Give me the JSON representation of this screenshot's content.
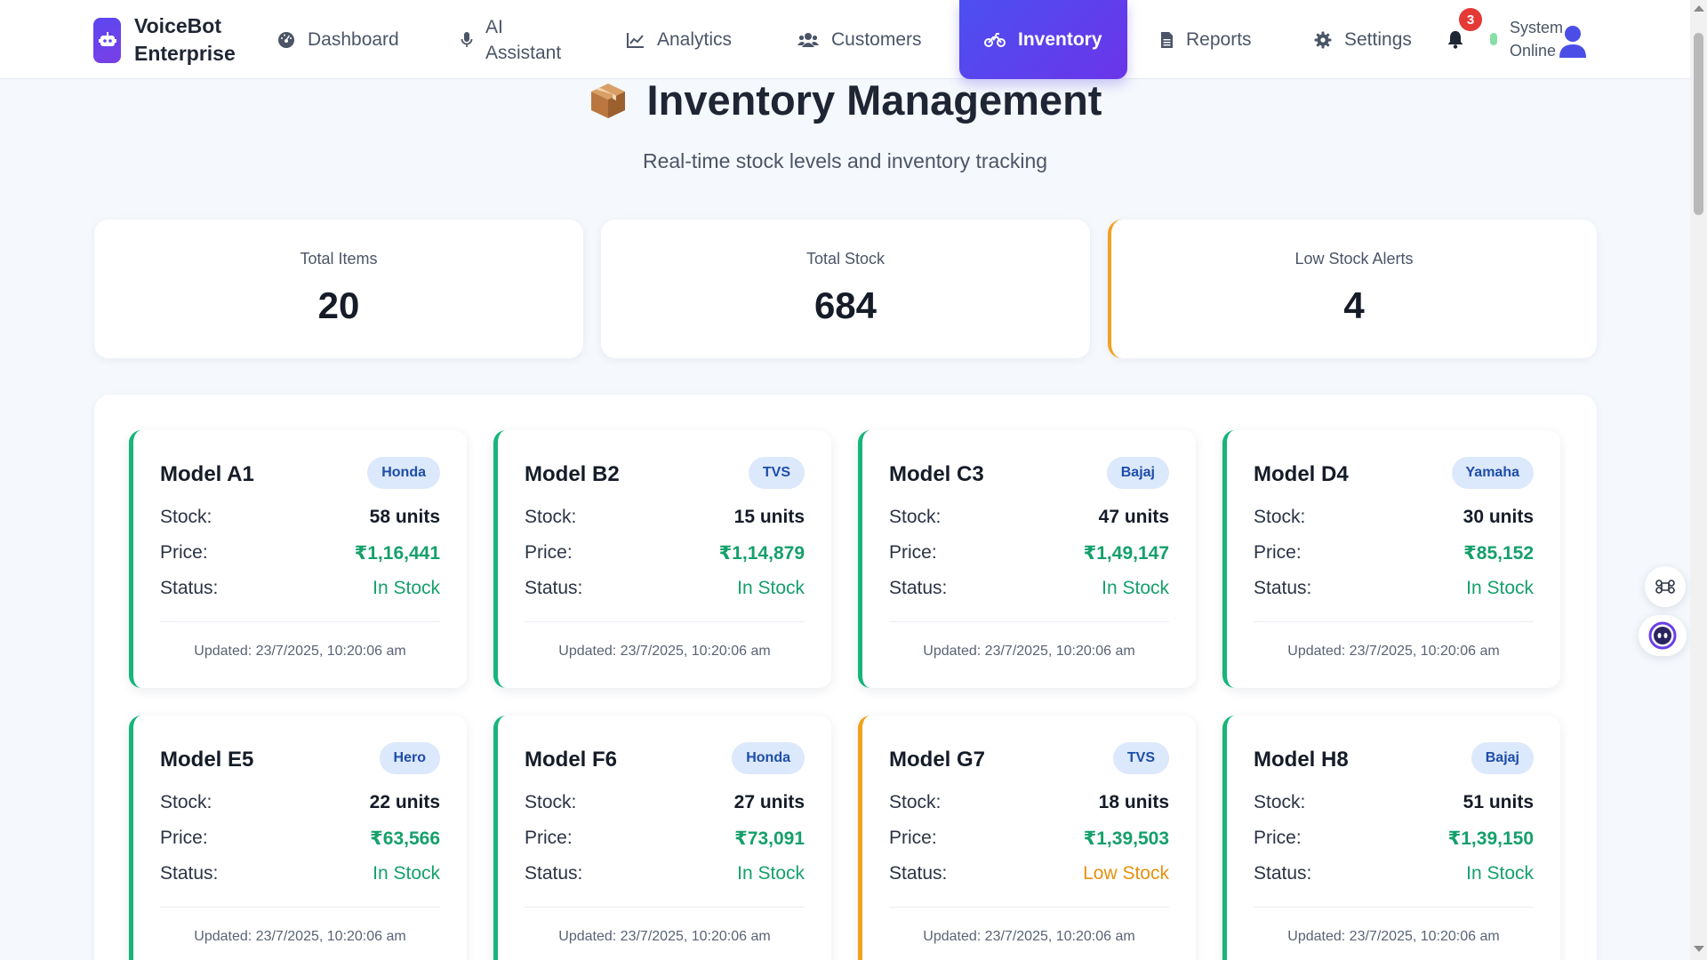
{
  "brand": {
    "name_line1": "VoiceBot",
    "name_line2": "Enterprise"
  },
  "nav": {
    "items": [
      {
        "label": "Dashboard",
        "icon": "gauge-icon"
      },
      {
        "label": "AI Assistant",
        "icon": "microphone-icon"
      },
      {
        "label": "Analytics",
        "icon": "line-chart-icon"
      },
      {
        "label": "Customers",
        "icon": "users-icon"
      },
      {
        "label": "Inventory",
        "icon": "motorcycle-icon",
        "active": true
      },
      {
        "label": "Reports",
        "icon": "document-icon"
      },
      {
        "label": "Settings",
        "icon": "gear-icon"
      }
    ],
    "notification_count": "3",
    "status": {
      "line1": "System",
      "line2": "Online"
    }
  },
  "page": {
    "title": "Inventory Management",
    "subtitle": "Real-time stock levels and inventory tracking"
  },
  "stats": [
    {
      "label": "Total Items",
      "value": "20"
    },
    {
      "label": "Total Stock",
      "value": "684"
    },
    {
      "label": "Low Stock Alerts",
      "value": "4"
    }
  ],
  "labels": {
    "stock": "Stock:",
    "price": "Price:",
    "status": "Status:"
  },
  "products": [
    {
      "name": "Model A1",
      "brand": "Honda",
      "stock": "58 units",
      "price": "₹1,16,441",
      "status": "In Stock",
      "updated": "Updated: 23/7/2025, 10:20:06 am"
    },
    {
      "name": "Model B2",
      "brand": "TVS",
      "stock": "15 units",
      "price": "₹1,14,879",
      "status": "In Stock",
      "updated": "Updated: 23/7/2025, 10:20:06 am"
    },
    {
      "name": "Model C3",
      "brand": "Bajaj",
      "stock": "47 units",
      "price": "₹1,49,147",
      "status": "In Stock",
      "updated": "Updated: 23/7/2025, 10:20:06 am"
    },
    {
      "name": "Model D4",
      "brand": "Yamaha",
      "stock": "30 units",
      "price": "₹85,152",
      "status": "In Stock",
      "updated": "Updated: 23/7/2025, 10:20:06 am"
    },
    {
      "name": "Model E5",
      "brand": "Hero",
      "stock": "22 units",
      "price": "₹63,566",
      "status": "In Stock",
      "updated": "Updated: 23/7/2025, 10:20:06 am"
    },
    {
      "name": "Model F6",
      "brand": "Honda",
      "stock": "27 units",
      "price": "₹73,091",
      "status": "In Stock",
      "updated": "Updated: 23/7/2025, 10:20:06 am"
    },
    {
      "name": "Model G7",
      "brand": "TVS",
      "stock": "18 units",
      "price": "₹1,39,503",
      "status": "Low Stock",
      "updated": "Updated: 23/7/2025, 10:20:06 am"
    },
    {
      "name": "Model H8",
      "brand": "Bajaj",
      "stock": "51 units",
      "price": "₹1,39,150",
      "status": "In Stock",
      "updated": "Updated: 23/7/2025, 10:20:06 am"
    }
  ],
  "colors": {
    "accent": "#5b47f0",
    "in_stock": "#15a06b",
    "low_stock": "#e8900f",
    "alert_badge": "#e53935"
  }
}
